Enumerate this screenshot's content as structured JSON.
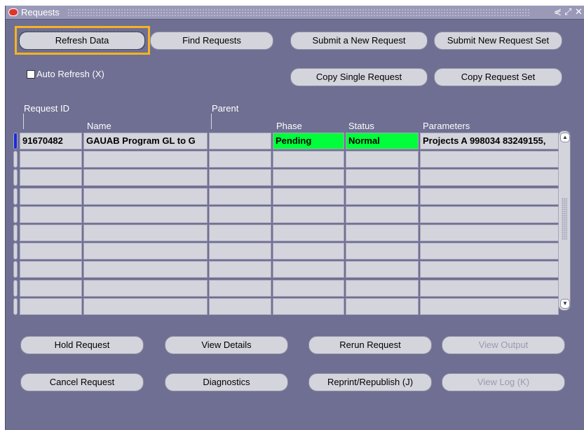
{
  "window": {
    "title": "Requests",
    "icons": [
      "minimize-icon",
      "maximize-icon",
      "close-icon"
    ],
    "icon_glyphs": [
      "⋞",
      "⤢",
      "✕"
    ]
  },
  "top_buttons": {
    "refresh": "Refresh Data",
    "find": "Find Requests",
    "submit_new": "Submit a New Request",
    "submit_set": "Submit New Request Set",
    "copy_single": "Copy Single Request",
    "copy_set": "Copy Request Set"
  },
  "auto_refresh": {
    "label": "Auto Refresh (X)",
    "checked": false
  },
  "table": {
    "headers": {
      "request_id": "Request ID",
      "name": "Name",
      "parent": "Parent",
      "phase": "Phase",
      "status": "Status",
      "parameters": "Parameters"
    },
    "rows": [
      {
        "request_id": "91670482",
        "name": "GAUAB Program GL to G",
        "parent": "",
        "phase": "Pending",
        "status": "Normal",
        "parameters": "Projects A 998034 83249155,"
      }
    ],
    "empty_rows": 9
  },
  "bottom_buttons": {
    "hold": "Hold Request",
    "view_details": "View Details",
    "rerun": "Rerun Request",
    "view_output": "View Output",
    "cancel": "Cancel Request",
    "diagnostics": "Diagnostics",
    "reprint": "Reprint/Republish (J)",
    "view_log": "View Log (K)"
  },
  "colors": {
    "background": "#6f6f93",
    "focus": "#f5b31f",
    "highlight": "#00ff3a",
    "selected_row": "#1a2bd8"
  }
}
